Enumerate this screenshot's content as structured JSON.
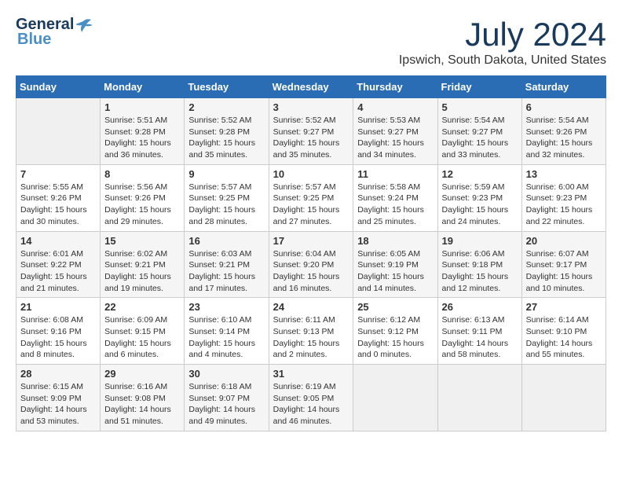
{
  "header": {
    "logo_general": "General",
    "logo_blue": "Blue",
    "title": "July 2024",
    "location": "Ipswich, South Dakota, United States"
  },
  "calendar": {
    "days_of_week": [
      "Sunday",
      "Monday",
      "Tuesday",
      "Wednesday",
      "Thursday",
      "Friday",
      "Saturday"
    ],
    "weeks": [
      [
        {
          "day": "",
          "info": ""
        },
        {
          "day": "1",
          "info": "Sunrise: 5:51 AM\nSunset: 9:28 PM\nDaylight: 15 hours\nand 36 minutes."
        },
        {
          "day": "2",
          "info": "Sunrise: 5:52 AM\nSunset: 9:28 PM\nDaylight: 15 hours\nand 35 minutes."
        },
        {
          "day": "3",
          "info": "Sunrise: 5:52 AM\nSunset: 9:27 PM\nDaylight: 15 hours\nand 35 minutes."
        },
        {
          "day": "4",
          "info": "Sunrise: 5:53 AM\nSunset: 9:27 PM\nDaylight: 15 hours\nand 34 minutes."
        },
        {
          "day": "5",
          "info": "Sunrise: 5:54 AM\nSunset: 9:27 PM\nDaylight: 15 hours\nand 33 minutes."
        },
        {
          "day": "6",
          "info": "Sunrise: 5:54 AM\nSunset: 9:26 PM\nDaylight: 15 hours\nand 32 minutes."
        }
      ],
      [
        {
          "day": "7",
          "info": "Sunrise: 5:55 AM\nSunset: 9:26 PM\nDaylight: 15 hours\nand 30 minutes."
        },
        {
          "day": "8",
          "info": "Sunrise: 5:56 AM\nSunset: 9:26 PM\nDaylight: 15 hours\nand 29 minutes."
        },
        {
          "day": "9",
          "info": "Sunrise: 5:57 AM\nSunset: 9:25 PM\nDaylight: 15 hours\nand 28 minutes."
        },
        {
          "day": "10",
          "info": "Sunrise: 5:57 AM\nSunset: 9:25 PM\nDaylight: 15 hours\nand 27 minutes."
        },
        {
          "day": "11",
          "info": "Sunrise: 5:58 AM\nSunset: 9:24 PM\nDaylight: 15 hours\nand 25 minutes."
        },
        {
          "day": "12",
          "info": "Sunrise: 5:59 AM\nSunset: 9:23 PM\nDaylight: 15 hours\nand 24 minutes."
        },
        {
          "day": "13",
          "info": "Sunrise: 6:00 AM\nSunset: 9:23 PM\nDaylight: 15 hours\nand 22 minutes."
        }
      ],
      [
        {
          "day": "14",
          "info": "Sunrise: 6:01 AM\nSunset: 9:22 PM\nDaylight: 15 hours\nand 21 minutes."
        },
        {
          "day": "15",
          "info": "Sunrise: 6:02 AM\nSunset: 9:21 PM\nDaylight: 15 hours\nand 19 minutes."
        },
        {
          "day": "16",
          "info": "Sunrise: 6:03 AM\nSunset: 9:21 PM\nDaylight: 15 hours\nand 17 minutes."
        },
        {
          "day": "17",
          "info": "Sunrise: 6:04 AM\nSunset: 9:20 PM\nDaylight: 15 hours\nand 16 minutes."
        },
        {
          "day": "18",
          "info": "Sunrise: 6:05 AM\nSunset: 9:19 PM\nDaylight: 15 hours\nand 14 minutes."
        },
        {
          "day": "19",
          "info": "Sunrise: 6:06 AM\nSunset: 9:18 PM\nDaylight: 15 hours\nand 12 minutes."
        },
        {
          "day": "20",
          "info": "Sunrise: 6:07 AM\nSunset: 9:17 PM\nDaylight: 15 hours\nand 10 minutes."
        }
      ],
      [
        {
          "day": "21",
          "info": "Sunrise: 6:08 AM\nSunset: 9:16 PM\nDaylight: 15 hours\nand 8 minutes."
        },
        {
          "day": "22",
          "info": "Sunrise: 6:09 AM\nSunset: 9:15 PM\nDaylight: 15 hours\nand 6 minutes."
        },
        {
          "day": "23",
          "info": "Sunrise: 6:10 AM\nSunset: 9:14 PM\nDaylight: 15 hours\nand 4 minutes."
        },
        {
          "day": "24",
          "info": "Sunrise: 6:11 AM\nSunset: 9:13 PM\nDaylight: 15 hours\nand 2 minutes."
        },
        {
          "day": "25",
          "info": "Sunrise: 6:12 AM\nSunset: 9:12 PM\nDaylight: 15 hours\nand 0 minutes."
        },
        {
          "day": "26",
          "info": "Sunrise: 6:13 AM\nSunset: 9:11 PM\nDaylight: 14 hours\nand 58 minutes."
        },
        {
          "day": "27",
          "info": "Sunrise: 6:14 AM\nSunset: 9:10 PM\nDaylight: 14 hours\nand 55 minutes."
        }
      ],
      [
        {
          "day": "28",
          "info": "Sunrise: 6:15 AM\nSunset: 9:09 PM\nDaylight: 14 hours\nand 53 minutes."
        },
        {
          "day": "29",
          "info": "Sunrise: 6:16 AM\nSunset: 9:08 PM\nDaylight: 14 hours\nand 51 minutes."
        },
        {
          "day": "30",
          "info": "Sunrise: 6:18 AM\nSunset: 9:07 PM\nDaylight: 14 hours\nand 49 minutes."
        },
        {
          "day": "31",
          "info": "Sunrise: 6:19 AM\nSunset: 9:05 PM\nDaylight: 14 hours\nand 46 minutes."
        },
        {
          "day": "",
          "info": ""
        },
        {
          "day": "",
          "info": ""
        },
        {
          "day": "",
          "info": ""
        }
      ]
    ]
  }
}
